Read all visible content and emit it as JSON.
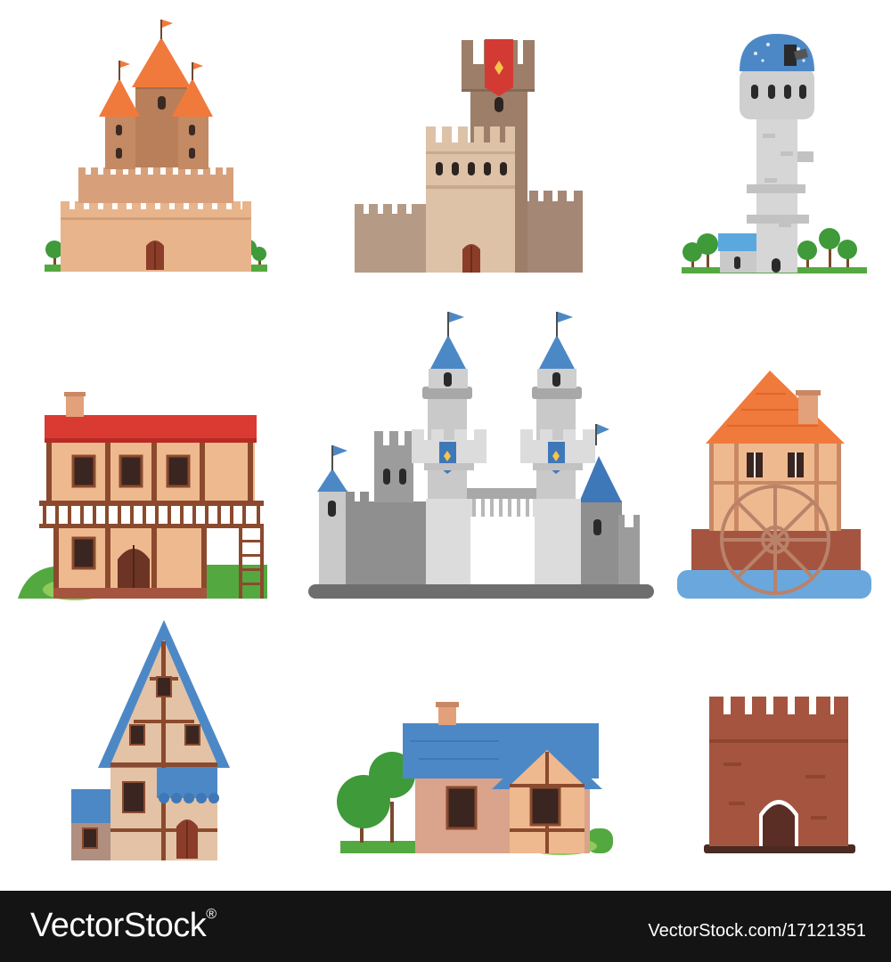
{
  "watermark": {
    "brand": "VectorStock",
    "registered_mark": "®",
    "image_id": "VectorStock.com/17121351"
  },
  "illustrations": [
    {
      "name": "castle-orange-turrets"
    },
    {
      "name": "stone-keep-with-banner"
    },
    {
      "name": "observatory-tower"
    },
    {
      "name": "two-storey-tavern"
    },
    {
      "name": "grey-stone-castle-with-gate"
    },
    {
      "name": "water-mill"
    },
    {
      "name": "tall-timber-house"
    },
    {
      "name": "cottage-blue-roof"
    },
    {
      "name": "brick-gatehouse"
    }
  ],
  "colors": {
    "orange_roof": "#f07a3c",
    "sand_wall": "#e8b48b",
    "stone_brown": "#b59a86",
    "grey_stone": "#a8a8a8",
    "light_stone": "#d6d6d6",
    "blue_roof": "#4d88c6",
    "red_roof": "#d93a32",
    "timber": "#8b4a2d",
    "grass": "#53a940",
    "brick": "#a5553f",
    "water": "#6aa7dd",
    "footer_bg": "#141414"
  }
}
